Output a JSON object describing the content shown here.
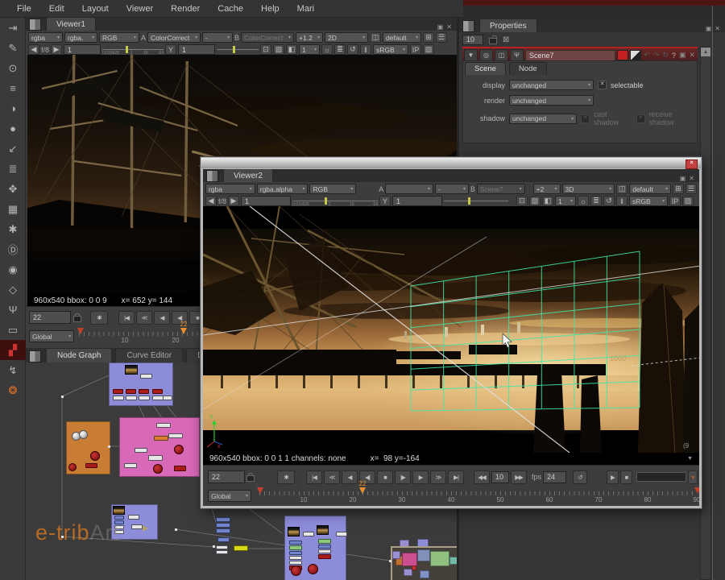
{
  "colors": {
    "accent_red": "#b22222",
    "marker_orange": "#e89030",
    "grid_green": "#3fe8a8",
    "backdrop_blue": "#8c8cd8",
    "backdrop_orange": "#c87c34",
    "backdrop_pink": "#d868b8",
    "node_red": "#aa1c1c",
    "node_yellow": "#d8d818",
    "node_green": "#8cc87c",
    "node_blue": "#7484cc"
  },
  "menubar": {
    "items": [
      "File",
      "Edit",
      "Layout",
      "Viewer",
      "Render",
      "Cache",
      "Help",
      "Mari"
    ]
  },
  "left_toolbar": {
    "icons": [
      {
        "name": "image-icon",
        "glyph": "⇥"
      },
      {
        "name": "draw-icon",
        "glyph": "✎"
      },
      {
        "name": "time-icon",
        "glyph": "⊙"
      },
      {
        "name": "channel-icon",
        "glyph": "≡"
      },
      {
        "name": "color-icon",
        "glyph": "◑"
      },
      {
        "name": "filter-icon",
        "glyph": "●"
      },
      {
        "name": "keyer-icon",
        "glyph": "↙"
      },
      {
        "name": "merge-icon",
        "glyph": "≣"
      },
      {
        "name": "transform-icon",
        "glyph": "✥"
      },
      {
        "name": "threed-icon",
        "glyph": "▦"
      },
      {
        "name": "particles-icon",
        "glyph": "✱"
      },
      {
        "name": "deep-icon",
        "glyph": "Ⓓ"
      },
      {
        "name": "views-icon",
        "glyph": "◉"
      },
      {
        "name": "toolsets-icon",
        "glyph": "◇"
      },
      {
        "name": "metadata-icon",
        "glyph": "Ψ"
      },
      {
        "name": "other-icon",
        "glyph": "▭"
      },
      {
        "name": "plugins-icon",
        "glyph": "▞"
      },
      {
        "name": "ofx-icon",
        "glyph": "↯"
      },
      {
        "name": "furnace-icon",
        "glyph": "❂"
      }
    ]
  },
  "transport_buttons": [
    "|◀",
    "≪",
    "◀",
    "◀|",
    "■",
    "|▶",
    "▶",
    "≫",
    "▶|"
  ],
  "slider_scale": [
    "0.015625",
    "1",
    "16",
    "64"
  ],
  "viewer1": {
    "tab": "Viewer1",
    "toolbar": {
      "layer": "rgba",
      "alpha": "rgba.",
      "display": "RGB",
      "a_label": "A",
      "a_value": "ColorCorrect",
      "mix": "-",
      "b_label": "B",
      "b_value": "ColorCorrect",
      "zoom": "+1.2",
      "mode": "2D",
      "stereo": "default"
    },
    "row2": {
      "fstop": "f/8",
      "gain": "1",
      "gamma_label": "Y",
      "gamma": "1",
      "inputs": "1",
      "colorspace": "sRGB",
      "ip": "IP"
    },
    "status_left": "960x540 bbox: 0 0 9",
    "status_right": "x= 652 y= 144",
    "transport": {
      "frame": "22",
      "range": "Global"
    },
    "ruler": {
      "labels": [
        "10",
        "20"
      ],
      "marker": "22"
    }
  },
  "viewer2": {
    "tab": "Viewer2",
    "toolbar": {
      "layer": "rgba",
      "alpha": "rgba.alpha",
      "display": "RGB",
      "a_label": "A",
      "a_value": "",
      "mix": "-",
      "b_label": "B",
      "b_value": "Scene7",
      "zoom": "+2",
      "mode": "3D",
      "stereo": "default"
    },
    "row2": {
      "fstop": "f/8",
      "gain": "1",
      "gamma_label": "Y",
      "gamma": "1",
      "inputs": "1",
      "colorspace": "sRGB",
      "ip": "IP"
    },
    "status_left": "960x540 bbox: 0 0 1 1 channels: none",
    "status_right": "x=  98 y=-164",
    "transport": {
      "frame": "22",
      "step": "10",
      "fps_label": "fps",
      "fps": "24",
      "range": "Global"
    },
    "ruler": {
      "labels": [
        "10",
        "20",
        "30",
        "40",
        "50",
        "60",
        "70",
        "80",
        "90"
      ],
      "marker": "22"
    },
    "overlay": {
      "depth": "1000",
      "corner": "(9",
      "axis_y": "Y",
      "axis_x": "x"
    }
  },
  "properties": {
    "tab": "Properties",
    "panel_count": "10",
    "node": {
      "name": "Scene7",
      "tabs": [
        "Scene",
        "Node"
      ],
      "display_label": "display",
      "display_value": "unchanged",
      "selectable": "selectable",
      "render_label": "render",
      "render_value": "unchanged",
      "shadow_label": "shadow",
      "shadow_value": "unchanged",
      "cast": "cast shadow",
      "receive": "receive shadow",
      "help": "?"
    }
  },
  "bottom_tabs": [
    "Node Graph",
    "Curve Editor",
    "Dope Sheet"
  ],
  "watermark": {
    "p1": "e-trib",
    "p2": "Art"
  },
  "icons": {
    "panel_menu": "▤",
    "float": "▣",
    "close": "✕",
    "camera": "◫",
    "fit": "⊞",
    "layout": "☰",
    "roi": "⊡",
    "proxy": "▧",
    "wipe": "◧",
    "gear": "☼",
    "scan": "≣",
    "refresh": "↺",
    "pause": "‖",
    "stripes": "▨",
    "snow": "✱",
    "prev": "◀◀",
    "next": "▶▶",
    "loop": "↺",
    "play": "▶",
    "stop": "■",
    "down": "▼",
    "up": "▲",
    "collapse": "▼",
    "center": "◎",
    "wrench": "Ψ",
    "bw": "◪",
    "undo": "↶",
    "redo": "↷",
    "revert": "↻",
    "clear": "⊠",
    "flip": "▾",
    "left": "◀",
    "right": "▶",
    "check": "✕"
  }
}
